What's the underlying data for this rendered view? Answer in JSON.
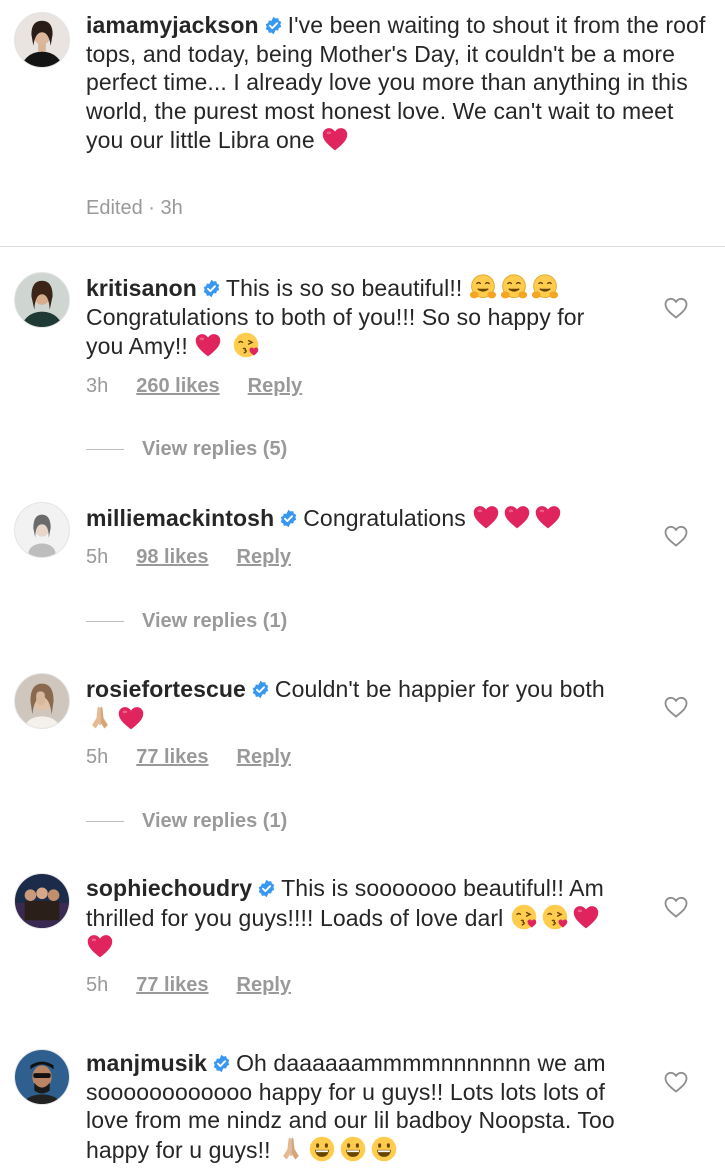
{
  "caption": {
    "username": "iamamyjackson",
    "text": "I've been waiting to shout it from the roof tops, and today, being Mother's Day, it couldn't be a more perfect time... I already love you more than anything in this world, the purest most honest love. We can't wait to meet you our little Libra one",
    "edited": "Edited · 3h"
  },
  "comments": [
    {
      "username": "kritisanon",
      "text1": "This is so so beautiful!!",
      "text2": "Congratulations to both of you!!! So so happy for you Amy!!",
      "time": "3h",
      "likes": "260 likes",
      "reply": "Reply",
      "view_replies": "View replies (5)"
    },
    {
      "username": "milliemackintosh",
      "text1": "Congratulations",
      "time": "5h",
      "likes": "98 likes",
      "reply": "Reply",
      "view_replies": "View replies (1)"
    },
    {
      "username": "rosiefortescue",
      "text1": "Couldn't be happier for you both",
      "time": "5h",
      "likes": "77 likes",
      "reply": "Reply",
      "view_replies": "View replies (1)"
    },
    {
      "username": "sophiechoudry",
      "text1": "This is sooooooo beautiful!! Am thrilled for you guys!!!! Loads of love darl",
      "time": "5h",
      "likes": "77 likes",
      "reply": "Reply"
    },
    {
      "username": "manjmusik",
      "text1": "Oh daaaaaammmmnnnnnnn we am soooooooooooo happy for u guys!! Lots lots lots of love from me nindz and our lil badboy Noopsta. Too happy for u guys!!"
    }
  ],
  "icons": {
    "verified": "verified-badge-icon",
    "heart_outline": "heart-outline-icon",
    "red_heart": "red-heart-emoji",
    "hug": "hugging-face-emoji",
    "kiss": "face-blowing-kiss-emoji",
    "pray": "folded-hands-emoji",
    "grin": "grinning-face-emoji"
  },
  "colors": {
    "verified_blue": "#3897f0",
    "meta_gray": "#999999",
    "heart_red": "#e0245e"
  }
}
